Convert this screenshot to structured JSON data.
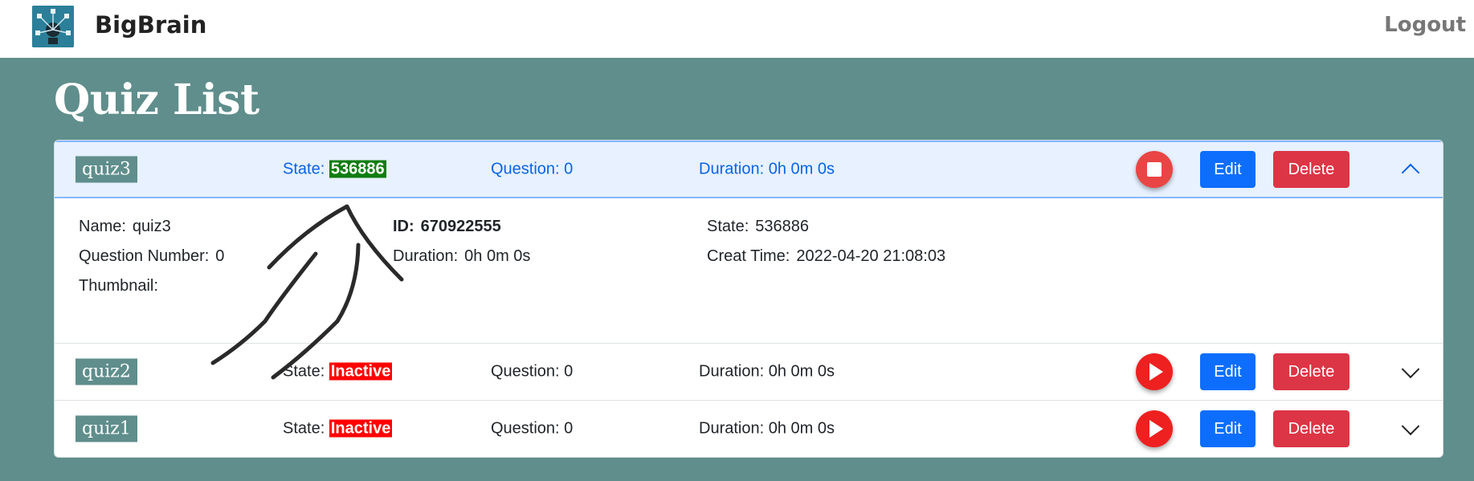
{
  "navbar": {
    "brand": "BigBrain",
    "logout": "Logout",
    "logo_icon": "brain-logo-icon"
  },
  "page": {
    "title": "Quiz List"
  },
  "quizzes": [
    {
      "name": "quiz3",
      "state_label": "State:",
      "state_value": "536886",
      "question": "Question: 0",
      "duration": "Duration: 0h 0m 0s",
      "action_icon": "stop-icon",
      "edit": "Edit",
      "delete": "Delete",
      "expanded": true,
      "details": {
        "name_label": "Name:",
        "name_value": "quiz3",
        "qnum_label": "Question Number:",
        "qnum_value": "0",
        "thumb_label": "Thumbnail:",
        "id_label": "ID:",
        "id_value": "670922555",
        "dur_label": "Duration:",
        "dur_value": "0h 0m 0s",
        "state_label": "State:",
        "state_value": "536886",
        "ctime_label": "Creat Time:",
        "ctime_value": "2022-04-20 21:08:03"
      }
    },
    {
      "name": "quiz2",
      "state_label": "State:",
      "state_value": "Inactive",
      "question": "Question: 0",
      "duration": "Duration: 0h 0m 0s",
      "action_icon": "play-icon",
      "edit": "Edit",
      "delete": "Delete",
      "expanded": false
    },
    {
      "name": "quiz1",
      "state_label": "State:",
      "state_value": "Inactive",
      "question": "Question: 0",
      "duration": "Duration: 0h 0m 0s",
      "action_icon": "play-icon",
      "edit": "Edit",
      "delete": "Delete",
      "expanded": false
    }
  ],
  "colors": {
    "background": "#5f8e8c",
    "active_state": "#0f7d0f",
    "inactive_state": "#ff0000",
    "primary": "#0d6efd",
    "danger": "#dc3545"
  }
}
